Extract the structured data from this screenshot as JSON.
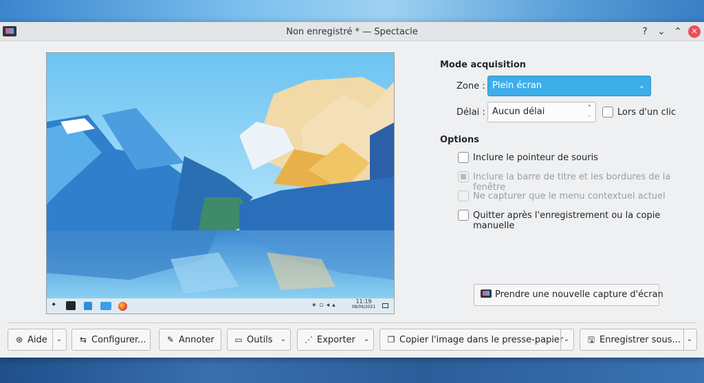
{
  "window": {
    "title": "Non enregistré * — Spectacle",
    "help_glyph": "?",
    "minimize_glyph": "⌄",
    "maximize_glyph": "⌃",
    "close_glyph": "✕"
  },
  "preview": {
    "taskbar_time": "11:19",
    "taskbar_date": "08/09/2021"
  },
  "acquisition": {
    "heading": "Mode acquisition",
    "zone_label": "Zone :",
    "zone_value": "Plein écran",
    "delay_label": "Délai :",
    "delay_value": "Aucun délai",
    "on_click_label": "Lors d'un clic"
  },
  "options": {
    "heading": "Options",
    "items": [
      {
        "label": "Inclure le pointeur de souris",
        "enabled": true,
        "checked": false
      },
      {
        "label": "Inclure la barre de titre et les bordures de la fenêtre",
        "enabled": false,
        "checked": "partial"
      },
      {
        "label": "Ne capturer que le menu contextuel actuel",
        "enabled": false,
        "checked": false
      },
      {
        "label": "Quitter après l'enregistrement ou la copie manuelle",
        "enabled": true,
        "checked": false
      }
    ]
  },
  "new_capture_label": "Prendre une nouvelle capture d'écran",
  "toolbar": {
    "help": "Aide",
    "configure": "Configurer...",
    "annotate": "Annoter",
    "tools": "Outils",
    "export": "Exporter",
    "copy": "Copier l'image dans le presse-papier",
    "save": "Enregistrer sous..."
  },
  "colors": {
    "accent": "#3daee9",
    "window_bg": "#eff0f1",
    "close": "#ed4e5b"
  }
}
